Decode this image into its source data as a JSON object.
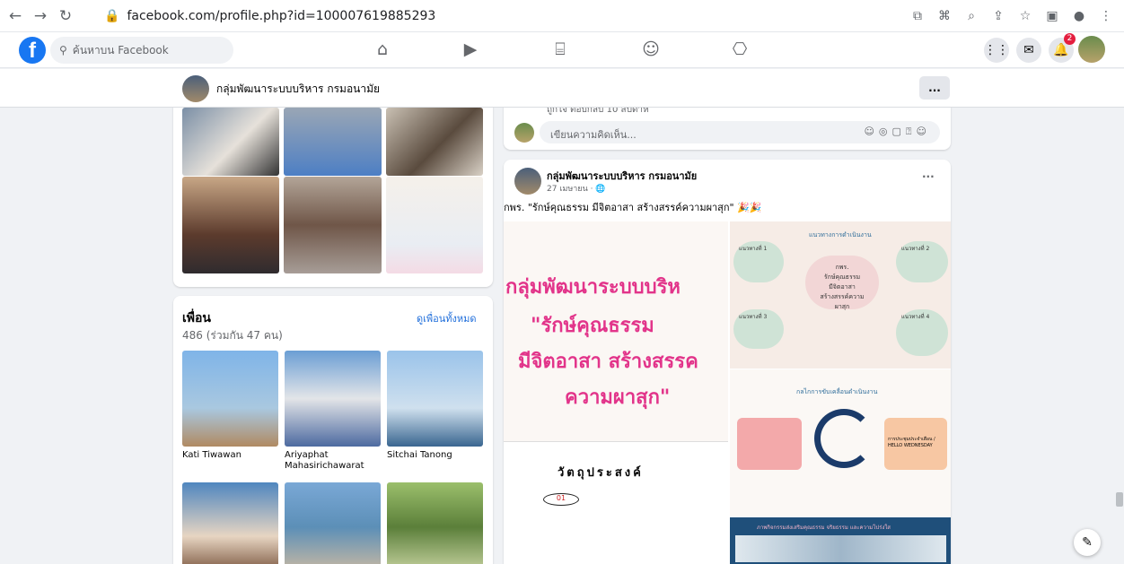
{
  "browser": {
    "url": "facebook.com/profile.php?id=100007619885293"
  },
  "fb": {
    "search_placeholder": "ค้นหาบน Facebook",
    "notif_count": "2"
  },
  "group": {
    "name": "กลุ่มพัฒนาระบบบริหาร กรมอนามัย",
    "more": "..."
  },
  "friends": {
    "title": "เพื่อน",
    "count": "486 (ร่วมกัน 47 คน)",
    "see_all": "ดูเพื่อนทั้งหมด",
    "items": [
      {
        "name": "Kati Tiwawan"
      },
      {
        "name": "Ariyaphat Mahasirichawarat"
      },
      {
        "name": "Sitchai Tanong"
      }
    ]
  },
  "comment": {
    "actions": "ถูกใจ   ตอบกลับ   10 สัปดาห์",
    "placeholder": "เขียนความคิดเห็น..."
  },
  "post": {
    "author": "กลุ่มพัฒนาระบบบริหาร กรมอนามัย",
    "date": "27 เมษายน · 🌐",
    "text": "กพร. \"รักษ์คุณธรรม มีจิตอาสา สร้างสรรค์ความผาสุก\" 🎉🎉",
    "img1_line1": "กลุ่มพัฒนาระบบบริห",
    "img1_line2": "\"รักษ์คุณธรรม",
    "img1_line3": "มีจิตอาสา สร้างสรรค",
    "img1_line4": "ความผาสุก\"",
    "img2_title": "แนวทางการดำเนินงาน",
    "img2_center": "กพร.\nรักษ์คุณธรรม\nมีจิตอาสา\nสร้างสรรค์ความ\nผาสุก",
    "img2_n1": "แนวทางที่ 1",
    "img2_n2": "แนวทางที่ 2",
    "img2_n3": "แนวทางที่ 3",
    "img2_n4": "แนวทางที่ 4",
    "img3_title": "กลไกการขับเคลื่อนดำเนินงาน",
    "img3_right": "การประชุมประจำเดือน / HELLO WEDNESDAY",
    "img4_title": "วัตถุประสงค์",
    "img4_num": "01",
    "img5_title": "ภาพกิจกรรมส่งเสริมคุณธรรม จริยธรรม และความโปร่งใส"
  }
}
